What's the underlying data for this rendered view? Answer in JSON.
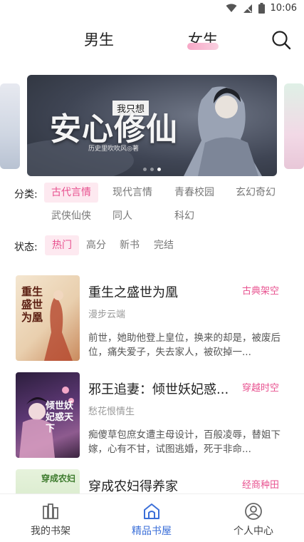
{
  "status_bar": {
    "time": "10:06"
  },
  "top_tabs": {
    "male": "男生",
    "female": "女生"
  },
  "banner": {
    "title": "安心修仙",
    "subtitle": "我只想",
    "author": "历史里吹吹风◎著",
    "slide_count": 3,
    "active_slide": 2
  },
  "category": {
    "label": "分类:",
    "options": [
      "古代言情",
      "现代言情",
      "青春校园",
      "玄幻奇幻",
      "武侠仙侠",
      "同人",
      "科幻"
    ],
    "selected": "古代言情"
  },
  "status_filter": {
    "label": "状态:",
    "options": [
      "热门",
      "高分",
      "新书",
      "完结"
    ],
    "selected": "热门"
  },
  "books": [
    {
      "title": "重生之盛世为凰",
      "tag": "古典架空",
      "author": "漫步云端",
      "desc": "前世，她助他登上皇位，换来的却是，被废后位，痛失爱子，失去家人，被砍掉一...",
      "cover_text": "重生盛世为凰"
    },
    {
      "title": "邪王追妻：倾世妖妃惑...",
      "tag": "穿越时空",
      "author": "愁花恨情生",
      "desc": "痴傻草包庶女遭主母设计，百般凌辱，替姐下嫁，心有不甘，试图逃婚，死于非命...",
      "cover_text": "倾世妖妃惑天下"
    },
    {
      "title": "穿成农妇得养家",
      "tag": "经商种田",
      "author": "",
      "desc": "",
      "cover_text": "穿成农妇"
    }
  ],
  "bottom_nav": {
    "items": [
      "我的书架",
      "精品书屋",
      "个人中心"
    ],
    "active": "精品书屋"
  },
  "colors": {
    "accent_pink": "#e8518f",
    "accent_blue": "#3b6fd8"
  }
}
